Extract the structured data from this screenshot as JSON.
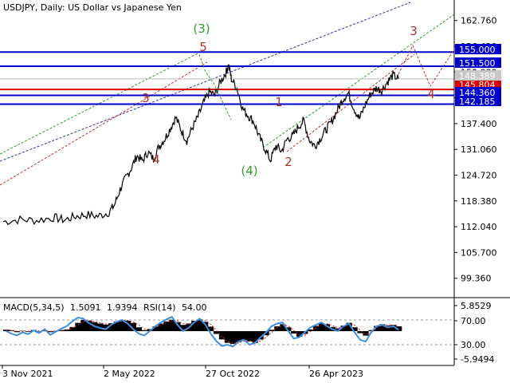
{
  "header": {
    "symbol": "USDJPY, Daily:",
    "description": "US Dollar vs Japanese Yen"
  },
  "indicator": {
    "macd_label": "MACD(5,34,5)",
    "macd_v1": "1.5091",
    "macd_v2": "1.9394",
    "rsi_label": "RSI(14)",
    "rsi_value": "54.00"
  },
  "colors": {
    "level_blue": "#0000cc",
    "level_red": "#dd0000",
    "wave_red": "#b03030",
    "wave_green": "#339933",
    "rsi_line": "#3d8fe0",
    "histogram": "#000000"
  },
  "chart_data": [
    {
      "type": "line",
      "series_kind": "candlestick-like daily price",
      "x_ticks": [
        "3 Nov 2021",
        "2 May 2022",
        "27 Oct 2022",
        "26 Apr 2023"
      ],
      "y_ticks": [
        162.76,
        156.42,
        150.08,
        143.74,
        137.4,
        131.06,
        124.72,
        118.38,
        112.04,
        105.7,
        99.36
      ],
      "y_tick_labels": [
        "162.760",
        "156.420",
        "150.080",
        "143.740",
        "137.400",
        "131.060",
        "124.720",
        "118.380",
        "112.040",
        "105.700",
        "99.360"
      ],
      "ylim": [
        94.6,
        167.8
      ],
      "current_price_label": "148.389",
      "current_price": 148.389,
      "levels": [
        {
          "label": "155.000",
          "value": 155.0,
          "color": "blue"
        },
        {
          "label": "151.500",
          "value": 151.5,
          "color": "blue"
        },
        {
          "label": "145.804",
          "value": 145.804,
          "color": "red"
        },
        {
          "label": "144.360",
          "value": 144.36,
          "color": "blue"
        },
        {
          "label": "142.185",
          "value": 142.185,
          "color": "blue"
        }
      ],
      "price_path": [
        {
          "t": 0,
          "v": 113.3
        },
        {
          "t": 3,
          "v": 113.8
        },
        {
          "t": 6,
          "v": 113.6
        },
        {
          "t": 9,
          "v": 114.3
        },
        {
          "t": 11,
          "v": 113.7
        },
        {
          "t": 13,
          "v": 114.6
        },
        {
          "t": 15,
          "v": 115.0
        },
        {
          "t": 17,
          "v": 114.6
        },
        {
          "t": 19,
          "v": 115.6
        },
        {
          "t": 20,
          "v": 117.4
        },
        {
          "t": 21,
          "v": 121.2
        },
        {
          "t": 22,
          "v": 124.0
        },
        {
          "t": 23,
          "v": 126.4
        },
        {
          "t": 24,
          "v": 129.5
        },
        {
          "t": 25,
          "v": 128.2
        },
        {
          "t": 26,
          "v": 130.4
        },
        {
          "t": 27,
          "v": 128.7
        },
        {
          "t": 28,
          "v": 131.8
        },
        {
          "t": 29,
          "v": 133.6
        },
        {
          "t": 30,
          "v": 136.2
        },
        {
          "t": 31,
          "v": 138.9
        },
        {
          "t": 32,
          "v": 135.7
        },
        {
          "t": 33,
          "v": 133.2
        },
        {
          "t": 34,
          "v": 136.4
        },
        {
          "t": 35,
          "v": 139.1
        },
        {
          "t": 36,
          "v": 142.5
        },
        {
          "t": 37,
          "v": 145.2
        },
        {
          "t": 38,
          "v": 144.4
        },
        {
          "t": 39,
          "v": 147.6
        },
        {
          "t": 40,
          "v": 149.9
        },
        {
          "t": 40.5,
          "v": 151.9
        },
        {
          "t": 41,
          "v": 148.4
        },
        {
          "t": 42,
          "v": 146.1
        },
        {
          "t": 43,
          "v": 141.1
        },
        {
          "t": 44,
          "v": 139.4
        },
        {
          "t": 45,
          "v": 137.9
        },
        {
          "t": 46,
          "v": 134.1
        },
        {
          "t": 47,
          "v": 131.3
        },
        {
          "t": 48,
          "v": 128.4
        },
        {
          "t": 49,
          "v": 131.9
        },
        {
          "t": 50,
          "v": 130.6
        },
        {
          "t": 51,
          "v": 133.6
        },
        {
          "t": 52,
          "v": 134.3
        },
        {
          "t": 53,
          "v": 136.6
        },
        {
          "t": 54,
          "v": 138.1
        },
        {
          "t": 55,
          "v": 133.4
        },
        {
          "t": 56,
          "v": 131.9
        },
        {
          "t": 57,
          "v": 133.8
        },
        {
          "t": 58,
          "v": 135.9
        },
        {
          "t": 59,
          "v": 137.9
        },
        {
          "t": 60,
          "v": 140.6
        },
        {
          "t": 61,
          "v": 143.4
        },
        {
          "t": 62,
          "v": 144.9
        },
        {
          "t": 63,
          "v": 141.2
        },
        {
          "t": 64,
          "v": 138.6
        },
        {
          "t": 65,
          "v": 141.9
        },
        {
          "t": 66,
          "v": 144.7
        },
        {
          "t": 67,
          "v": 146.1
        },
        {
          "t": 68,
          "v": 145.6
        },
        {
          "t": 69,
          "v": 147.6
        },
        {
          "t": 70,
          "v": 149.3
        },
        {
          "t": 71,
          "v": 148.4
        }
      ],
      "wave_labels": [
        {
          "label": "3",
          "color": "red"
        },
        {
          "label": "4",
          "color": "red"
        },
        {
          "label": "5",
          "color": "red"
        },
        {
          "label": "(3)",
          "color": "green"
        },
        {
          "label": "(4)",
          "color": "green"
        },
        {
          "label": "1",
          "color": "red"
        },
        {
          "label": "2",
          "color": "red"
        },
        {
          "label": "3",
          "color": "red"
        },
        {
          "label": "4",
          "color": "red"
        }
      ]
    },
    {
      "type": "bar",
      "series_kind": "MACD histogram with RSI overlay",
      "y_tick_labels": [
        "5.8529",
        "70.00",
        "30.00",
        "-5.9494"
      ],
      "rsi_levels": [
        70,
        30
      ],
      "ylim": [
        -5.9494,
        5.8529
      ],
      "macd_hist": [
        0.4,
        0.2,
        -0.3,
        0.1,
        -0.2,
        0.3,
        -0.1,
        0.2,
        -0.3,
        0.1,
        0.3,
        0.5,
        1.2,
        2.4,
        3.2,
        3.0,
        2.6,
        2.2,
        1.9,
        2.3,
        2.8,
        3.2,
        3.0,
        2.4,
        1.1,
        0.3,
        0.6,
        1.4,
        2.2,
        2.8,
        3.3,
        2.6,
        1.8,
        2.2,
        3.0,
        3.4,
        2.7,
        1.3,
        -0.8,
        -2.4,
        -3.4,
        -3.7,
        -3.2,
        -2.6,
        -3.0,
        -3.4,
        -2.4,
        -1.2,
        0.4,
        1.4,
        2.0,
        1.1,
        -0.7,
        -1.6,
        -0.8,
        0.5,
        1.5,
        2.3,
        2.0,
        1.2,
        0.8,
        1.6,
        2.4,
        1.1,
        -0.6,
        -1.3,
        0.3,
        1.5,
        2.0,
        1.6,
        1.8,
        1.4
      ],
      "rsi": [
        52,
        48,
        45,
        50,
        47,
        53,
        49,
        55,
        46,
        51,
        56,
        60,
        68,
        74,
        72,
        65,
        60,
        57,
        55,
        62,
        67,
        70,
        64,
        55,
        48,
        45,
        52,
        60,
        66,
        71,
        75,
        62,
        52,
        57,
        66,
        72,
        63,
        48,
        36,
        28,
        30,
        27,
        35,
        38,
        30,
        33,
        42,
        50,
        60,
        64,
        66,
        52,
        40,
        42,
        50,
        58,
        62,
        66,
        60,
        55,
        52,
        60,
        64,
        50,
        38,
        35,
        50,
        60,
        62,
        58,
        60,
        54
      ]
    }
  ]
}
